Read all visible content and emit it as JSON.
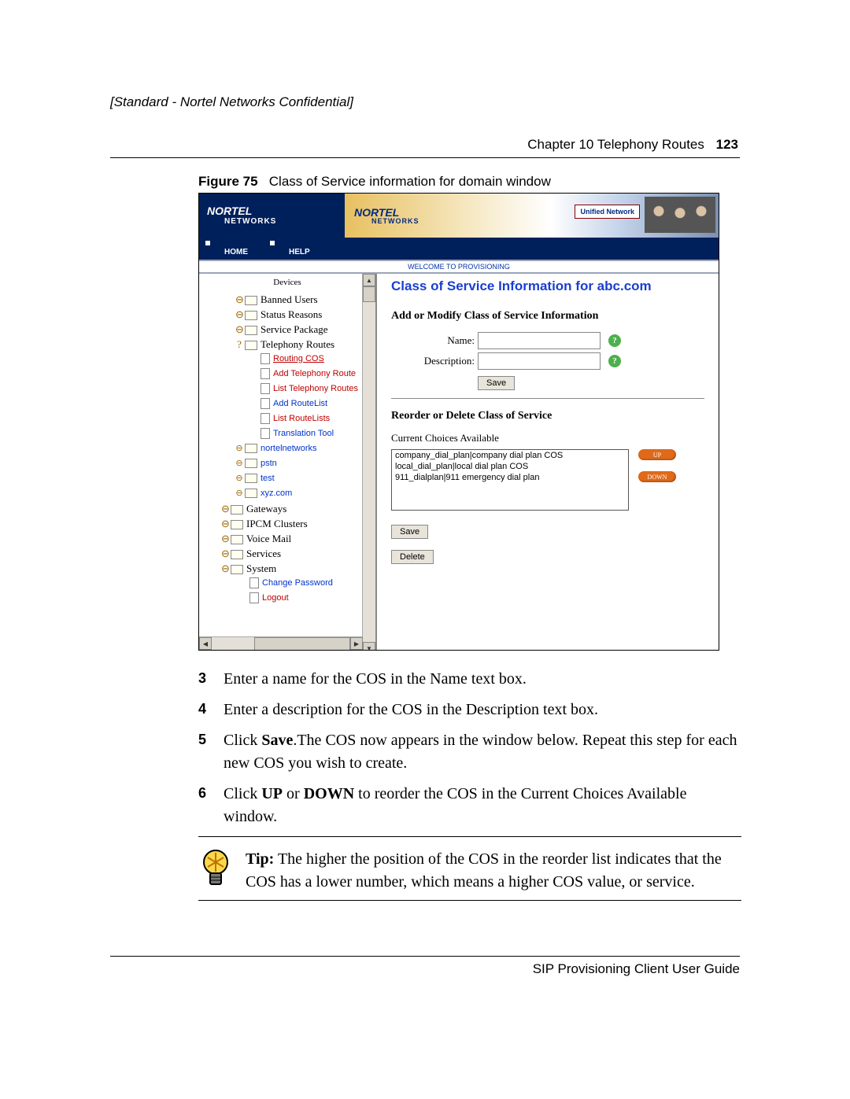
{
  "confidential": "[Standard - Nortel Networks Confidential]",
  "header": {
    "chapter": "Chapter 10  Telephony Routes",
    "page": "123"
  },
  "figure": {
    "label": "Figure 75",
    "caption": "Class of Service information for domain window"
  },
  "brand": {
    "name": "NORTEL",
    "sub": "NETWORKS",
    "tag": "Unified Network"
  },
  "nav": {
    "home": "HOME",
    "help": "HELP"
  },
  "welcome": "WELCOME TO PROVISIONING",
  "sidebar": {
    "devices": "Devices",
    "items_lvl1": [
      "Banned Users",
      "Status Reasons",
      "Service Package",
      "Telephony Routes"
    ],
    "routes": [
      "Routing COS",
      "Add Telephony Route",
      "List Telephony Routes",
      "Add RouteList",
      "List RouteLists",
      "Translation Tool"
    ],
    "domains": [
      "nortelnetworks",
      "pstn",
      "test",
      "xyz.com"
    ],
    "bottom": [
      "Gateways",
      "IPCM Clusters",
      "Voice Mail",
      "Services",
      "System"
    ],
    "system_children": [
      "Change Password",
      "Logout"
    ]
  },
  "main": {
    "title": "Class of Service Information for abc.com",
    "addmod": "Add or Modify Class of Service Information",
    "name_label": "Name:",
    "desc_label": "Description:",
    "save": "Save",
    "reorder": "Reorder or Delete Class of Service",
    "current": "Current Choices Available",
    "choices": [
      "company_dial_plan|company dial plan COS",
      "local_dial_plan|local dial plan COS",
      "911_dialplan|911 emergency dial plan"
    ],
    "up": "UP",
    "down": "DOWN",
    "delete": "Delete"
  },
  "steps": {
    "s3": "Enter a name for the COS in the Name text box.",
    "s4": "Enter a description for the COS in the Description text box.",
    "s5a": "Click ",
    "s5b": "Save",
    "s5c": ".The COS now appears in the window below. Repeat this step for each new COS you wish to create.",
    "s6a": "Click ",
    "s6b": "UP",
    "s6c": " or ",
    "s6d": "DOWN",
    "s6e": " to reorder the COS in the Current Choices Available window."
  },
  "tip": {
    "label": "Tip:",
    "text": " The higher the position of the COS in the reorder list indicates that the COS has a lower number, which means a higher COS value, or service."
  },
  "footer": "SIP Provisioning Client User Guide"
}
